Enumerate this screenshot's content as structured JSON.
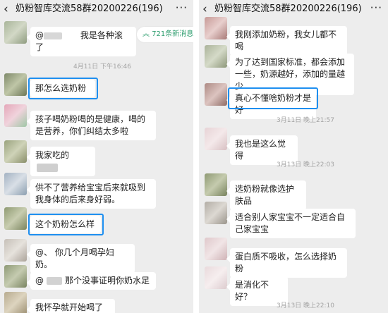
{
  "left": {
    "header": {
      "back": "‹",
      "title": "奶粉智库交流58群20200226(196)",
      "more": "···"
    },
    "new_messages": "721条新消息",
    "new_messages_arrow": "︽",
    "messages": [
      {
        "text_a": "@",
        "text_b": "我是各种滚",
        "text_c": "了"
      },
      {
        "timestamp": "4月11日 下午16:46"
      },
      {
        "text": "那怎么选奶粉"
      },
      {
        "text": "孩子喝奶粉喝的是健康，喝的是营养，你们纠结太多啦"
      },
      {
        "text": "我家吃的"
      },
      {
        "text": "供不了营养给宝宝后来就吸到我身体的后来身好弱。"
      },
      {
        "text": "这个奶粉怎么样"
      },
      {
        "text": "@、  你几个月喝孕妇奶。"
      },
      {
        "text_a": "@",
        "text_b": "那个没事证明你奶水足"
      },
      {
        "text": "我怀孕就开始喝了"
      }
    ]
  },
  "right": {
    "header": {
      "back": "‹",
      "title": "奶粉智库交流58群20200226(196)",
      "more": "···"
    },
    "messages": [
      {
        "text": "我刚添加奶粉，我女儿都不喝"
      },
      {
        "text": "为了达到国家标准，都会添加一些，奶源越好，添加的量越少"
      },
      {
        "text": "真心不懂啥奶粉才是好"
      },
      {
        "timestamp": "3月11日 晚上21:57"
      },
      {
        "text": "我也是这么觉得"
      },
      {
        "timestamp": "3月13日 晚上22:03"
      },
      {
        "text": "选奶粉就像选护肤品"
      },
      {
        "text": "适合别人家宝宝不一定适合自己家宝宝"
      },
      {
        "text": "蛋白质不吸收，怎么选择奶粉"
      },
      {
        "text": "是消化不好？"
      },
      {
        "timestamp": "3月13日 晚上22:10"
      }
    ]
  },
  "colors": {
    "highlight": "#1e8ff0",
    "chat_bg": "#ededed",
    "bubble": "#ffffff",
    "new_msg_badge": "#2f9e6f"
  }
}
